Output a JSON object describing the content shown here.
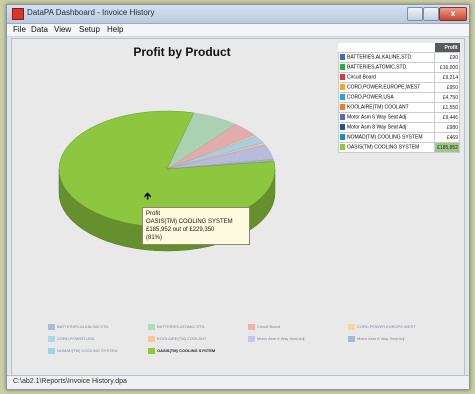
{
  "window": {
    "title": "DataPA Dashboard - Invoice History",
    "close_label": "x"
  },
  "menu": [
    {
      "label": "File"
    },
    {
      "label": "Data"
    },
    {
      "label": "View"
    },
    {
      "label": "Setup"
    },
    {
      "label": "Help"
    }
  ],
  "chart_data": {
    "type": "pie",
    "title": "Profit by Product",
    "value_header": "Profit",
    "slices": [
      {
        "label": "BATTERIES,ALKALINE,STD.",
        "value": 90,
        "display": "£90",
        "color": "#3e6fb0"
      },
      {
        "label": "BATTERIES,ATOMIC,STD.",
        "value": 16000,
        "display": "£16,000",
        "color": "#37a84a"
      },
      {
        "label": "Circuit Board",
        "value": 9214,
        "display": "£9,214",
        "color": "#d83b3b"
      },
      {
        "label": "CORD,POWER,EUROPE,WEST",
        "value": 950,
        "display": "£950",
        "color": "#f2a33a"
      },
      {
        "label": "CORD,POWER,USA",
        "value": 4750,
        "display": "£4,750",
        "color": "#2e9fd6"
      },
      {
        "label": "KOOLAIRE(TM) COOLANT",
        "value": 1550,
        "display": "£1,550",
        "color": "#f07b2c"
      },
      {
        "label": "Motor Asm 6 Way Seat Adj",
        "value": 9446,
        "display": "£9,446",
        "color": "#5c66c4"
      },
      {
        "label": "Motor Asm 8 Way Seat Adj",
        "value": 980,
        "display": "£980",
        "color": "#2f4f86"
      },
      {
        "label": "NOMAD(TM) COOLING SYSTEM",
        "value": 469,
        "display": "£469",
        "color": "#1b8fa8"
      },
      {
        "label": "OASIS(TM) COOLING SYSTEM",
        "value": 185952,
        "display": "£185,952",
        "color": "#8dc63f",
        "highlight": true
      }
    ],
    "legend_placement": "right"
  },
  "tooltip": {
    "line1": "Profit",
    "line2": "OASIS(TM) COOLING SYSTEM",
    "line3": "£185,952 out of £229,350",
    "line4": "(81%)"
  },
  "bottom_legend": [
    {
      "label": "BATTERIES,ALKALINE,STD.",
      "color": "#a9bcd7"
    },
    {
      "label": "BATTERIES,ATOMIC,STD.",
      "color": "#b5dcb8"
    },
    {
      "label": "Circuit Board",
      "color": "#eeb2b2"
    },
    {
      "label": "CORD,POWER,EUROPE,WEST",
      "color": "#f6d4a4"
    },
    {
      "label": "CORD,POWER,USA",
      "color": "#a9d7ec"
    },
    {
      "label": "KOOLAIRE(TM) COOLANT",
      "color": "#f6c6a4"
    },
    {
      "label": "Motor Asm 6 Way Seat Adj",
      "color": "#c1c6ea"
    },
    {
      "label": "Motor Asm 8 Way Seat Adj",
      "color": "#aab6ca"
    },
    {
      "label": "NOMAD(TM) COOLING SYSTEM",
      "color": "#a4d4dd"
    },
    {
      "label": "OASIS(TM) COOLING SYSTEM",
      "color": "#8dc63f",
      "active": true
    }
  ],
  "status": {
    "path": "C:\\ab2.1\\Reports\\Invoice History.dpa"
  }
}
